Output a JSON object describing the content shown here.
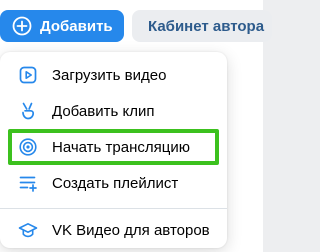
{
  "header": {
    "add_label": "Добавить",
    "author_label": "Кабинет автора"
  },
  "menu": {
    "items": [
      {
        "label": "Загрузить видео"
      },
      {
        "label": "Добавить клип"
      },
      {
        "label": "Начать трансляцию"
      },
      {
        "label": "Создать плейлист"
      },
      {
        "label": "VK Видео для авторов"
      }
    ]
  },
  "colors": {
    "accent_blue": "#2688eb",
    "icon_blue": "#2688eb",
    "highlight_green": "#3cc11e",
    "secondary_text": "#2d5b8c"
  },
  "icons": {
    "add": "plus-circle-icon",
    "upload": "upload-video-icon",
    "clip": "clip-hand-icon",
    "broadcast": "broadcast-icon",
    "playlist": "add-playlist-icon",
    "authors": "graduation-cap-icon"
  }
}
